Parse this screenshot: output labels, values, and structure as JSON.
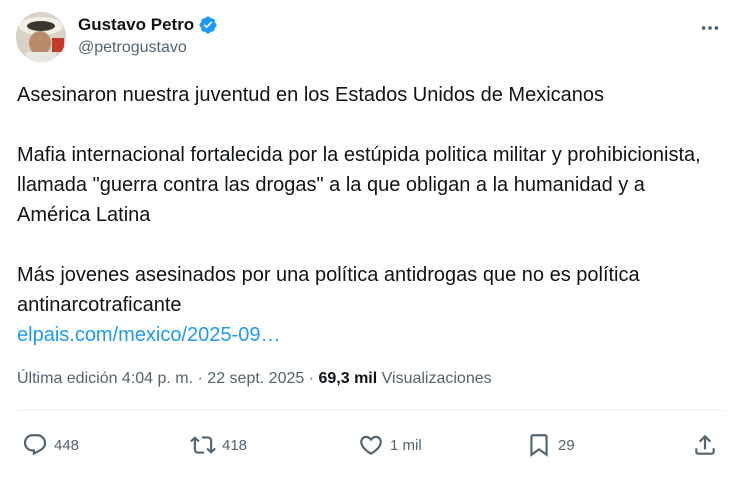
{
  "author": {
    "name": "Gustavo Petro",
    "handle": "@petrogustavo"
  },
  "tweet": {
    "paragraphs": [
      "Asesinaron nuestra juventud en los Estados Unidos de Mexicanos",
      "Mafia internacional fortalecida por la estúpida politica militar y prohibicionista, llamada \"guerra contra las drogas\" a la que obligan a la humanidad y a América Latina",
      "Más jovenes asesinados por una política antidrogas que no es política antinarcotraficante"
    ],
    "link": "elpais.com/mexico/2025-09…"
  },
  "meta": {
    "edited_prefix": "Última edición 4:04 p. m. · 22 sept. 2025 · ",
    "views_count": "69,3 mil",
    "views_label": " Visualizaciones"
  },
  "actions": {
    "replies": "448",
    "reposts": "418",
    "likes": "1 mil",
    "bookmarks": "29"
  },
  "colors": {
    "text": "#0f1419",
    "secondary": "#536471",
    "link": "#1d9bf0",
    "verified": "#1d9bf0"
  },
  "icons": {
    "verified": "verified-badge-icon",
    "more": "more-options-icon",
    "reply": "reply-icon",
    "repost": "repost-icon",
    "like": "like-icon",
    "bookmark": "bookmark-icon",
    "share": "share-icon"
  }
}
